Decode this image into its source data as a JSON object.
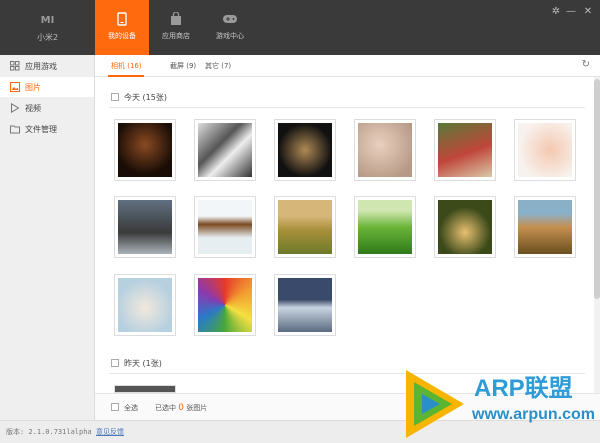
{
  "app": {
    "logo": "MI",
    "device_name": "小米2"
  },
  "top_nav": [
    {
      "label": "我的设备",
      "icon": "phone-icon",
      "active": true
    },
    {
      "label": "应用商店",
      "icon": "bag-icon",
      "active": false
    },
    {
      "label": "游戏中心",
      "icon": "gamepad-icon",
      "active": false
    }
  ],
  "window_controls": {
    "settings": "✲",
    "minimize": "—",
    "close": "✕"
  },
  "sidebar": [
    {
      "label": "应用游戏",
      "icon": "grid-icon",
      "active": false
    },
    {
      "label": "图片",
      "icon": "picture-icon",
      "active": true
    },
    {
      "label": "视频",
      "icon": "play-icon",
      "active": false
    },
    {
      "label": "文件管理",
      "icon": "folder-icon",
      "active": false
    }
  ],
  "tabs": [
    {
      "label": "相机",
      "count": "(16)",
      "active": true
    },
    {
      "label": "截屏",
      "count": "(9)",
      "active": false
    },
    {
      "label": "其它",
      "count": "(7)",
      "active": false
    }
  ],
  "refresh_icon": "↻",
  "groups": [
    {
      "label": "今天 (15张)"
    },
    {
      "label": "昨天 (1张)"
    }
  ],
  "photos": [
    "dark-portrait",
    "shoes",
    "smoker",
    "face-closeup",
    "game-board",
    "baby",
    "window-room",
    "bear-waterfall",
    "field-sunset",
    "green-hills",
    "forest-path",
    "hill-trees",
    "dog",
    "hot-air-balloon",
    "city-skyline"
  ],
  "footer": {
    "select_all": "全选",
    "selected_prefix": "已选中",
    "selected_count": "0",
    "selected_suffix": "张图片"
  },
  "status": {
    "version": "版本: 2.1.0.731lalpha",
    "feedback": "意见反馈"
  },
  "watermark": {
    "title": "ARP联盟",
    "url": "www.arpun.com"
  },
  "colors": {
    "accent": "#ff6a0f",
    "topbar": "#3a3a3a"
  }
}
